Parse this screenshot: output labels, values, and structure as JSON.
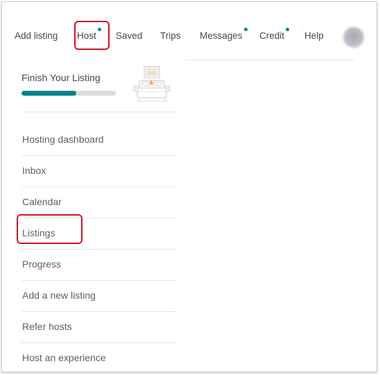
{
  "nav": {
    "items": [
      {
        "label": "Add listing",
        "dot": false
      },
      {
        "label": "Host",
        "dot": true
      },
      {
        "label": "Saved",
        "dot": false
      },
      {
        "label": "Trips",
        "dot": false
      },
      {
        "label": "Messages",
        "dot": true
      },
      {
        "label": "Credit",
        "dot": true
      },
      {
        "label": "Help",
        "dot": false
      }
    ],
    "avatar_icon": "avatar-blurred"
  },
  "dropdown": {
    "finish_card": {
      "title": "Finish Your Listing",
      "progress_fraction": 0.58,
      "illustration": "bed-icon"
    },
    "items": [
      "Hosting dashboard",
      "Inbox",
      "Calendar",
      "Listings",
      "Progress",
      "Add a new listing",
      "Refer hosts",
      "Host an experience"
    ]
  },
  "annotations": {
    "highlighted": [
      "Host",
      "Listings"
    ],
    "highlight_color": "#d0112b"
  },
  "colors": {
    "accent": "#00848a",
    "text": "#484848",
    "progress_track": "#dcdcdc"
  }
}
